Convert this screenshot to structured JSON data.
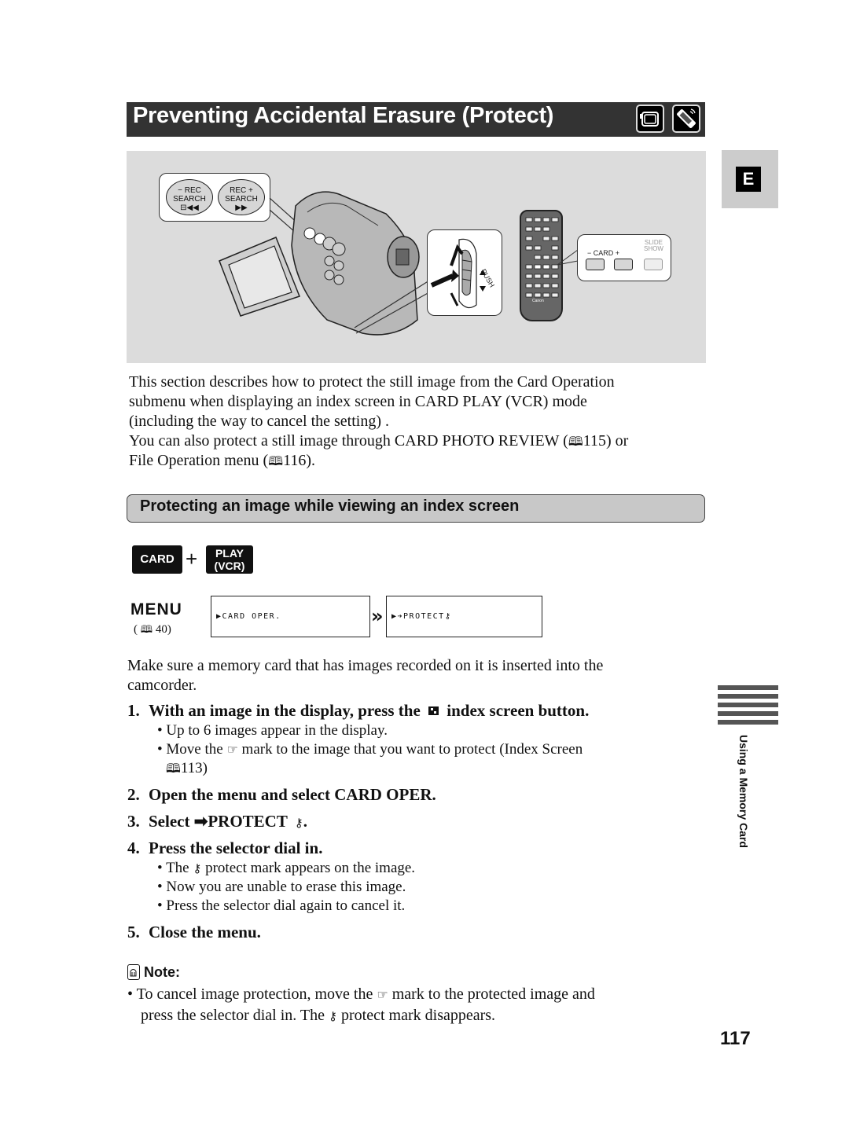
{
  "header": {
    "title": "Preventing Accidental Erasure (Protect)",
    "icons": [
      "camcorder-icon",
      "remote-control-icon"
    ]
  },
  "language_tab": "E",
  "illustration": {
    "camera_buttons": [
      {
        "line1": "− REC",
        "line2": "SEARCH",
        "line3": "⊟◀◀"
      },
      {
        "line1": "REC +",
        "line2": "SEARCH",
        "line3": "▶▶"
      }
    ],
    "dial_label": "PUSH",
    "remote_callout": {
      "card_label": "− CARD +",
      "slide_show_label_1": "SLIDE",
      "slide_show_label_2": "SHOW"
    },
    "remote_brand": "Canon"
  },
  "intro": {
    "lines": [
      "This section describes how to protect the still image from the Card Operation",
      "submenu when displaying an index screen in CARD PLAY (VCR) mode",
      "(including the way to cancel the setting) ."
    ],
    "line4_pre": "You can also protect a still image through CARD PHOTO REVIEW (",
    "line4_ref": "115",
    "line4_post": ") or",
    "line5_pre": "File Operation menu (",
    "line5_ref": "116",
    "line5_post": ")."
  },
  "section": {
    "title": "Protecting an image while viewing an index screen"
  },
  "mode": {
    "card": "CARD",
    "plus": "+",
    "play_1": "PLAY",
    "play_2": "(VCR)"
  },
  "menu_diagram": {
    "menu_label": "MENU",
    "menu_ref_pre": "(",
    "menu_ref": "40)",
    "screen1": "▶CARD OPER.",
    "screen2": "▶➔PROTECT",
    "arrow": "»"
  },
  "pre_step": {
    "line1": "Make sure a memory card that has images recorded on it is inserted into the",
    "line2": "camcorder."
  },
  "steps": [
    {
      "num": "1.",
      "text_pre": "With an image in the display, press the",
      "text_post": "index screen button.",
      "bullets": [
        "Up to 6 images appear in the display.",
        "Move the",
        "mark to the image that you want to protect (Index Screen"
      ],
      "ref": "113)"
    },
    {
      "num": "2.",
      "text": "Open the menu and select CARD OPER."
    },
    {
      "num": "3.",
      "text_pre": "Select ",
      "text": "➡PROTECT",
      "text_post": "."
    },
    {
      "num": "4.",
      "text": "Press the selector dial in.",
      "bullets": [
        "The",
        "protect mark appears on the image.",
        "Now you are unable to erase this image.",
        "Press the selector dial again to cancel it."
      ]
    },
    {
      "num": "5.",
      "text": "Close the menu."
    }
  ],
  "note": {
    "heading": "Note:",
    "line1_pre": "To cancel image protection, move the",
    "line1_post": "mark to the protected image and",
    "line2_pre": "press the selector dial in. The",
    "line2_post": "protect mark disappears."
  },
  "side_tab": {
    "label": "Using a Memory Card"
  },
  "page_number": "117"
}
